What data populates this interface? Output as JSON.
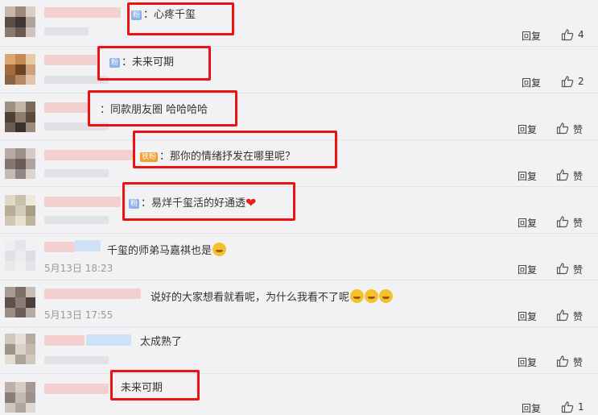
{
  "reply_label": "回复",
  "like_label": "赞",
  "comments": [
    {
      "badge": "粉",
      "badge_style": "blue",
      "text": "：心疼千玺",
      "likes": "4",
      "date": ""
    },
    {
      "badge": "粉",
      "badge_style": "blue",
      "text": "：未来可期",
      "likes": "2",
      "date": ""
    },
    {
      "badge": "",
      "badge_style": "",
      "text": "：同款朋友圈 哈哈哈哈",
      "likes": "",
      "date": ""
    },
    {
      "badge": "铁粉",
      "badge_style": "orange",
      "text": "：那你的情绪抒发在哪里呢？",
      "likes": "",
      "date": ""
    },
    {
      "badge": "粉",
      "badge_style": "blue",
      "text": "：易烊千玺活的好通透",
      "likes": "",
      "date": ""
    },
    {
      "badge": "",
      "badge_style": "",
      "text": "千玺的师弟马嘉祺也是",
      "likes": "",
      "date": "5月13日 18:23"
    },
    {
      "badge": "",
      "badge_style": "",
      "text": "说好的大家想看就看呢，为什么我看不了呢",
      "likes": "",
      "date": "5月13日 17:55"
    },
    {
      "badge": "",
      "badge_style": "",
      "text": "太成熟了",
      "likes": "",
      "date": ""
    },
    {
      "badge": "",
      "badge_style": "",
      "text": "未来可期",
      "likes": "1",
      "date": ""
    }
  ],
  "colors": {
    "highlight_box": "#ee1111",
    "reply_text": "#333333",
    "separator": "#e3e3e8"
  }
}
